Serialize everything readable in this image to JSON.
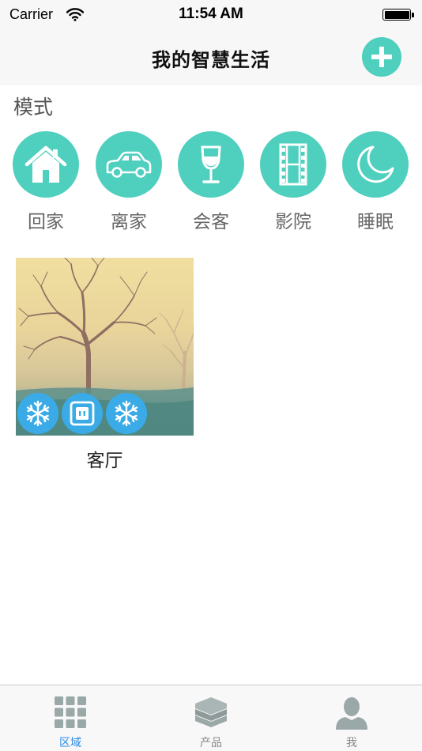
{
  "status_bar": {
    "carrier": "Carrier",
    "time": "11:54 AM"
  },
  "nav": {
    "title": "我的智慧生活",
    "add_icon": "plus-icon",
    "accent": "#4fcfbe"
  },
  "modes_section": {
    "label": "模式",
    "items": [
      {
        "label": "回家",
        "icon": "house-icon"
      },
      {
        "label": "离家",
        "icon": "car-icon"
      },
      {
        "label": "会客",
        "icon": "wine-glass-icon"
      },
      {
        "label": "影院",
        "icon": "film-icon"
      },
      {
        "label": "睡眠",
        "icon": "moon-icon"
      }
    ]
  },
  "rooms": [
    {
      "name": "客厅",
      "image": "misty-tree-photo",
      "devices": [
        {
          "icon": "snowflake-icon"
        },
        {
          "icon": "socket-icon"
        },
        {
          "icon": "snowflake-icon"
        }
      ],
      "device_color": "#3aabe6"
    }
  ],
  "tab_bar": {
    "active_color": "#2a8ae8",
    "tabs": [
      {
        "label": "区域",
        "icon": "grid-icon",
        "active": true
      },
      {
        "label": "产品",
        "icon": "layers-icon",
        "active": false
      },
      {
        "label": "我",
        "icon": "person-icon",
        "active": false
      }
    ]
  }
}
